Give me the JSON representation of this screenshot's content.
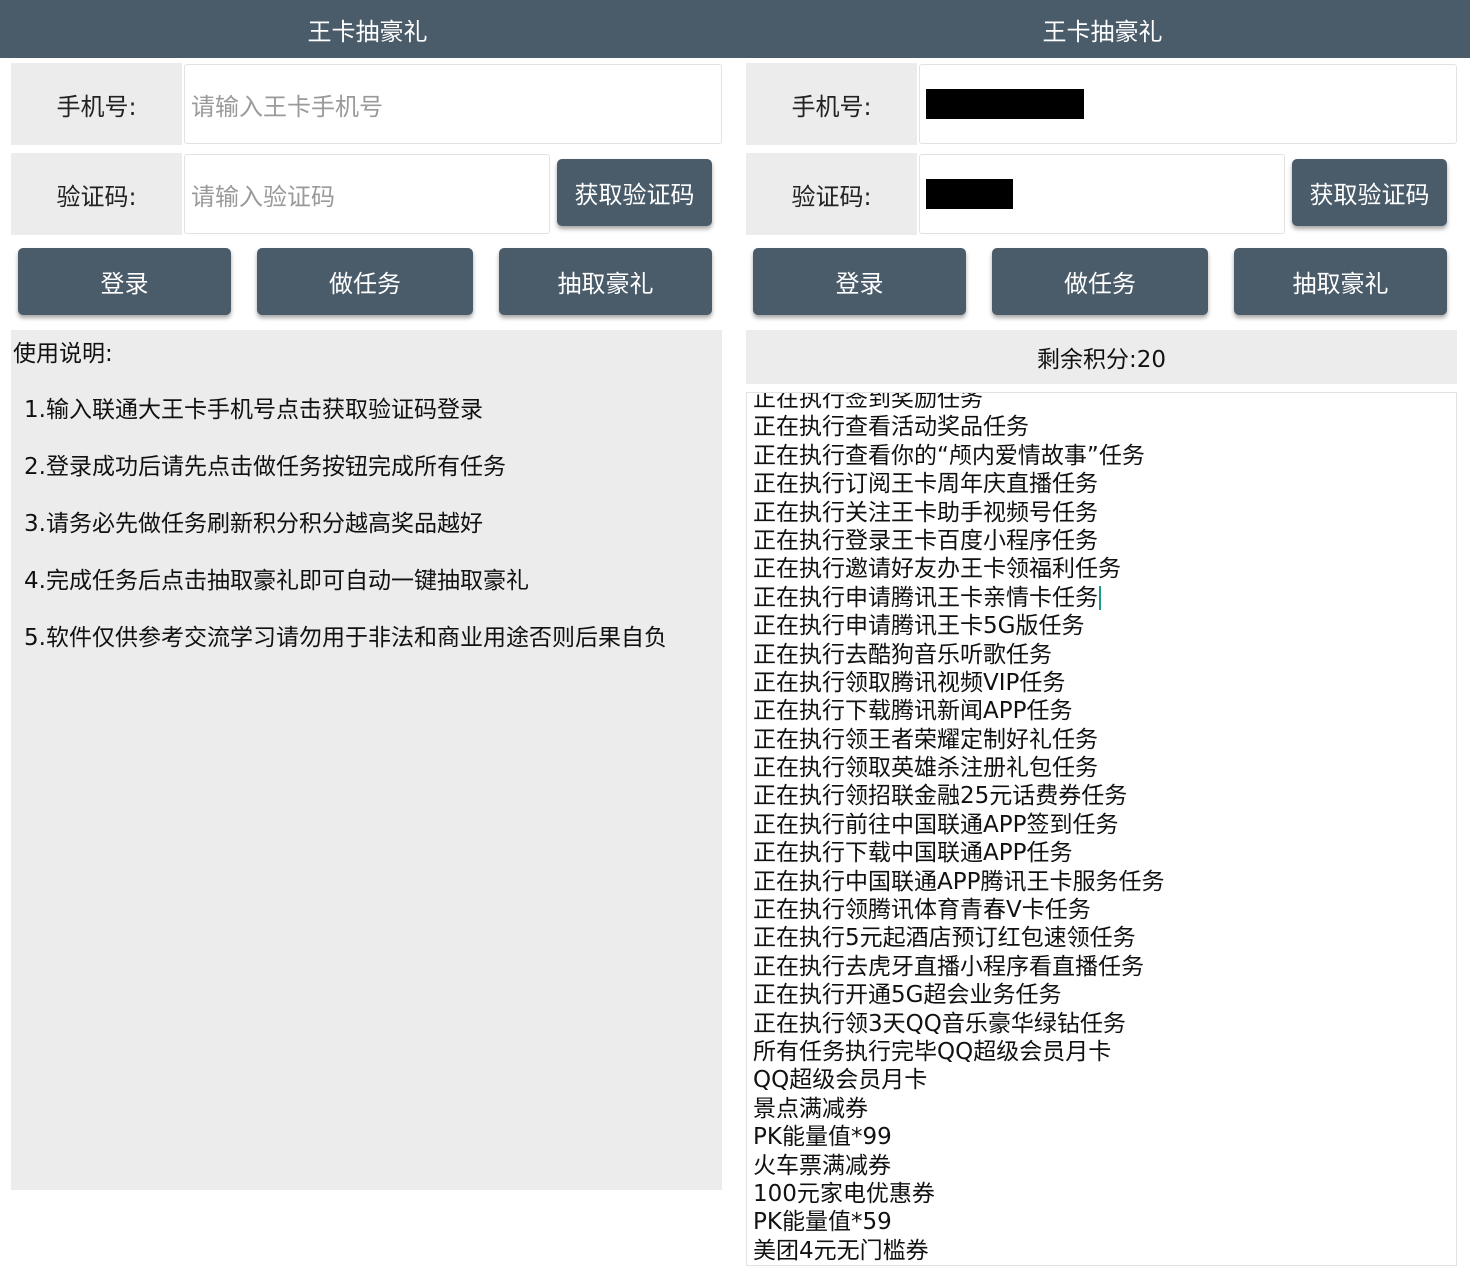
{
  "left": {
    "title": "王卡抽豪礼",
    "phone_label": "手机号:",
    "phone_placeholder": "请输入王卡手机号",
    "code_label": "验证码:",
    "code_placeholder": "请输入验证码",
    "get_code_button": "获取验证码",
    "login_button": "登录",
    "task_button": "做任务",
    "draw_button": "抽取豪礼",
    "instructions_title": "使用说明:",
    "instructions": [
      "1.输入联通大王卡手机号点击获取验证码登录",
      "2.登录成功后请先点击做任务按钮完成所有任务",
      "3.请务必先做任务刷新积分积分越高奖品越好",
      "4.完成任务后点击抽取豪礼即可自动一键抽取豪礼",
      "5.软件仅供参考交流学习请勿用于非法和商业用途否则后果自负"
    ]
  },
  "right": {
    "title": "王卡抽豪礼",
    "phone_label": "手机号:",
    "code_label": "验证码:",
    "get_code_button": "获取验证码",
    "login_button": "登录",
    "task_button": "做任务",
    "draw_button": "抽取豪礼",
    "points_text": "剩余积分:20",
    "log": [
      "正在执行签到奖励任务",
      "正在执行查看活动奖品任务",
      "正在执行查看你的“颅内爱情故事”任务",
      "正在执行订阅王卡周年庆直播任务",
      "正在执行关注王卡助手视频号任务",
      "正在执行登录王卡百度小程序任务",
      "正在执行邀请好友办王卡领福利任务",
      "正在执行申请腾讯王卡亲情卡任务",
      "正在执行申请腾讯王卡5G版任务",
      "正在执行去酷狗音乐听歌任务",
      "正在执行领取腾讯视频VIP任务",
      "正在执行下载腾讯新闻APP任务",
      "正在执行领王者荣耀定制好礼任务",
      "正在执行领取英雄杀注册礼包任务",
      "正在执行领招联金融25元话费券任务",
      "正在执行前往中国联通APP签到任务",
      "正在执行下载中国联通APP任务",
      "正在执行中国联通APP腾讯王卡服务任务",
      "正在执行领腾讯体育青春V卡任务",
      "正在执行5元起酒店预订红包速领任务",
      "正在执行去虎牙直播小程序看直播任务",
      "正在执行开通5G超会业务任务",
      "正在执行领3天QQ音乐豪华绿钻任务",
      "所有任务执行完毕QQ超级会员月卡",
      "QQ超级会员月卡",
      "景点满减券",
      "PK能量值*99",
      "火车票满减券",
      "100元家电优惠券",
      "PK能量值*59",
      "美团4元无门槛券"
    ]
  }
}
